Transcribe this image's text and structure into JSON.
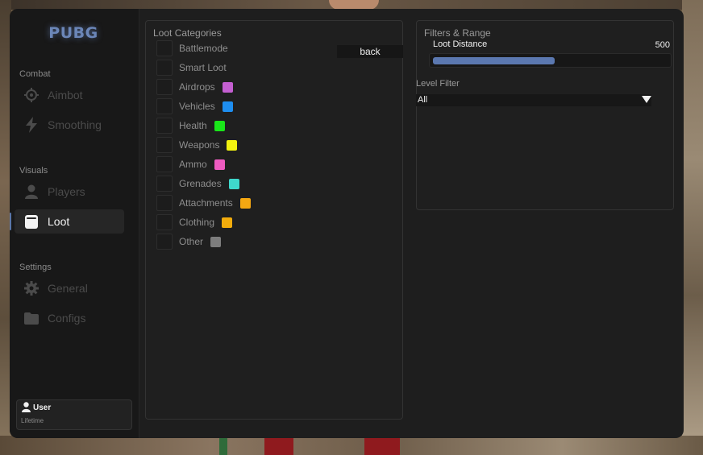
{
  "app": {
    "logo": "PUBG"
  },
  "sidebar": {
    "sections": [
      {
        "label": "Combat"
      },
      {
        "label": "Visuals"
      },
      {
        "label": "Settings"
      }
    ],
    "items": [
      {
        "label": "Aimbot",
        "icon": "crosshair-icon",
        "active": false
      },
      {
        "label": "Smoothing",
        "icon": "lightning-icon",
        "active": false
      },
      {
        "label": "Players",
        "icon": "person-icon",
        "active": false
      },
      {
        "label": "Loot",
        "icon": "box-icon",
        "active": true
      },
      {
        "label": "General",
        "icon": "gear-icon",
        "active": false
      },
      {
        "label": "Configs",
        "icon": "folder-icon",
        "active": false
      }
    ],
    "user": {
      "name": "User",
      "subtitle": "Lifetime"
    }
  },
  "loot_panel": {
    "title": "Loot Categories",
    "back_label": "back",
    "options": [
      {
        "label": "Battlemode",
        "checked": false,
        "color": null
      },
      {
        "label": "Smart Loot",
        "checked": false,
        "color": null
      },
      {
        "label": "Airdrops",
        "checked": false,
        "color": "#c45fd1"
      },
      {
        "label": "Vehicles",
        "checked": false,
        "color": "#1e8ef0"
      },
      {
        "label": "Health",
        "checked": false,
        "color": "#19e619"
      },
      {
        "label": "Weapons",
        "checked": false,
        "color": "#f2f20f"
      },
      {
        "label": "Ammo",
        "checked": false,
        "color": "#ee5bc0"
      },
      {
        "label": "Grenades",
        "checked": false,
        "color": "#3fd8cc"
      },
      {
        "label": "Attachments",
        "checked": false,
        "color": "#f5a812"
      },
      {
        "label": "Clothing",
        "checked": false,
        "color": "#f2ac0c"
      },
      {
        "label": "Other",
        "checked": false,
        "color": "#7d7d7d"
      }
    ]
  },
  "filters_panel": {
    "title": "Filters & Range",
    "loot_distance": {
      "label": "Loot Distance",
      "value": "500",
      "fraction": 0.52
    },
    "level_filter": {
      "label": "Level Filter",
      "selected": "All"
    }
  },
  "colors": {
    "accent": "#5b78b0",
    "background": "#1e1e1e",
    "sidebar": "#181818"
  }
}
